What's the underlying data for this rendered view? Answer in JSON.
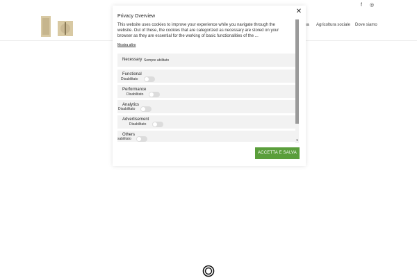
{
  "topbar": {
    "facebook_icon": "facebook-icon",
    "instagram_icon": "instagram-icon",
    "facebook_glyph": "f",
    "instagram_glyph": "◎"
  },
  "nav": {
    "items": [
      "na",
      "Agricoltura sociale",
      "Dove siamo"
    ]
  },
  "modal": {
    "title": "Privacy Overview",
    "close_label": "✕",
    "description": "This website uses cookies to improve your experience while you navigate through the website. Out of these, the cookies that are categorized as necessary are stored on your browser as they are essential for the working of basic functionalities of the ...",
    "show_more": "Mostra altro",
    "categories": [
      {
        "name": "Necessary",
        "status": "Sempre abilitato"
      },
      {
        "name": "Functional",
        "status": "Disabilitato"
      },
      {
        "name": "Performance",
        "status": "Disabilitato"
      },
      {
        "name": "Analytics",
        "status": "Disabilitato"
      },
      {
        "name": "Advertisement",
        "status": "Disabilitato"
      },
      {
        "name": "Others",
        "status": "sabilitato"
      }
    ],
    "save_button": "ACCETTA E SALVA"
  },
  "colors": {
    "accent": "#5a9e3b",
    "row_bg": "#f2f2f2"
  }
}
